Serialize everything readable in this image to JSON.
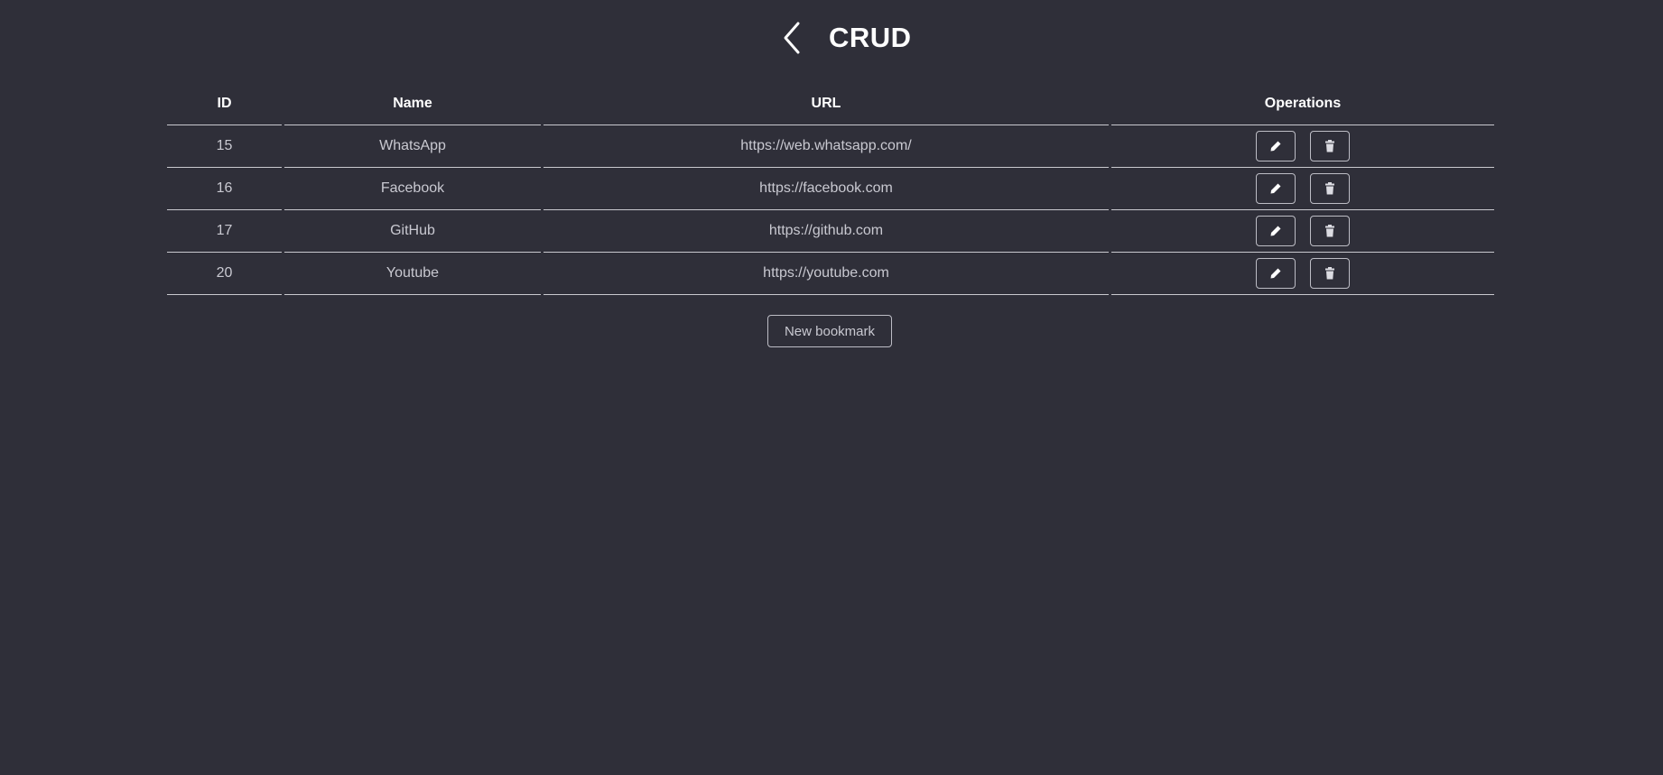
{
  "header": {
    "title": "CRUD",
    "back_icon": "chevron-left-icon"
  },
  "table": {
    "columns": [
      "ID",
      "Name",
      "URL",
      "Operations"
    ],
    "rows": [
      {
        "id": "15",
        "name": "WhatsApp",
        "url": "https://web.whatsapp.com/"
      },
      {
        "id": "16",
        "name": "Facebook",
        "url": "https://facebook.com"
      },
      {
        "id": "17",
        "name": "GitHub",
        "url": "https://github.com"
      },
      {
        "id": "20",
        "name": "Youtube",
        "url": "https://youtube.com"
      }
    ],
    "operation_icons": [
      "pencil-icon",
      "trash-icon"
    ]
  },
  "actions": {
    "new_bookmark_label": "New bookmark"
  },
  "colors": {
    "background": "#2f2f39",
    "text": "#c9c9d1",
    "heading": "#ffffff",
    "border": "#c9c9cf"
  }
}
